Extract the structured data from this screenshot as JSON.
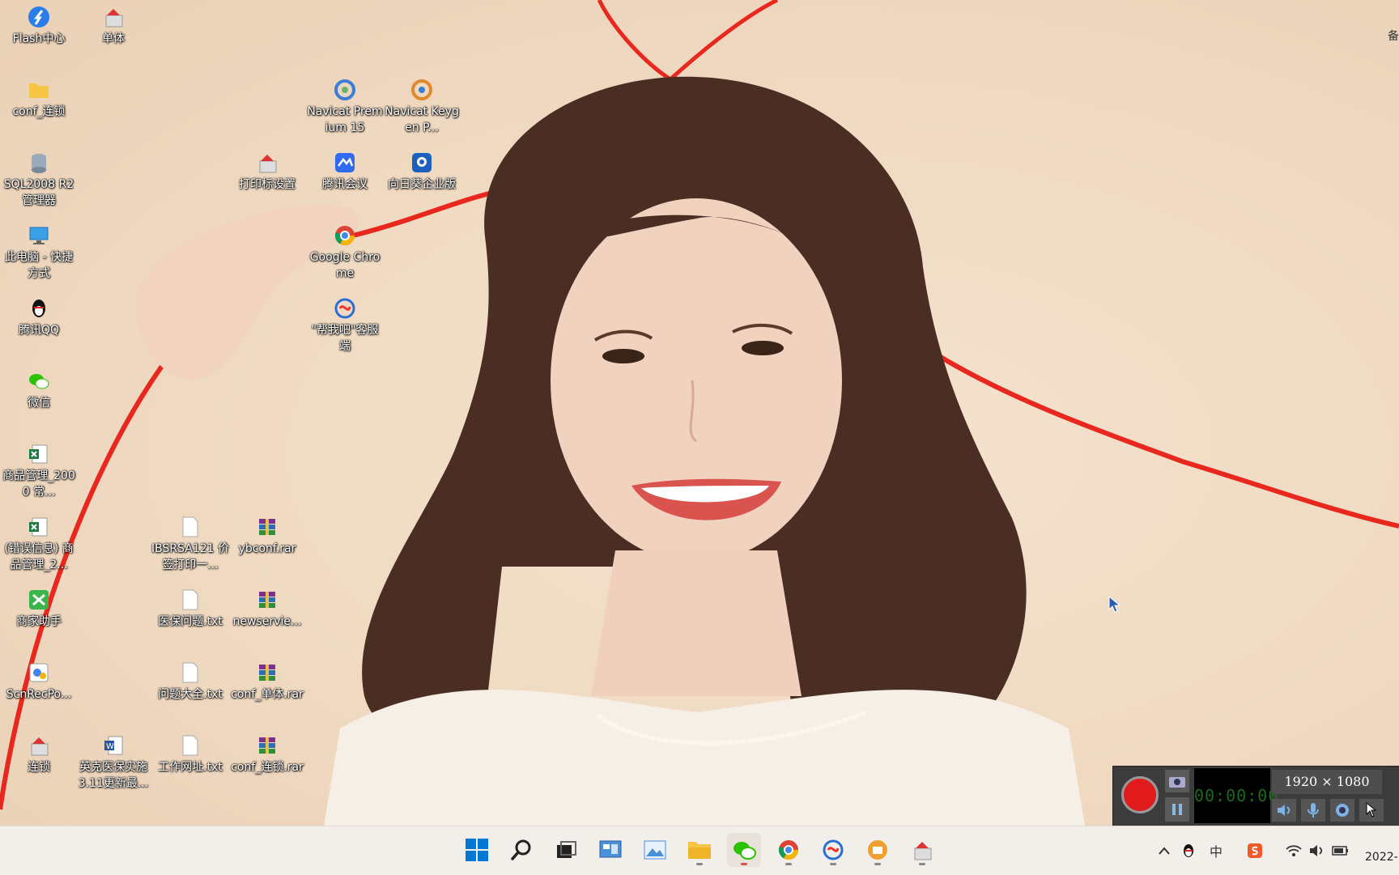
{
  "desktop": {
    "icons": [
      {
        "label": "Flash中心"
      },
      {
        "label": "单体"
      },
      {
        "label": "conf_连锁"
      },
      {
        "label": "Navicat Premium 15"
      },
      {
        "label": "Navicat Keygen P..."
      },
      {
        "label": "SQL2008 R2 管理器"
      },
      {
        "label": "打印标设置"
      },
      {
        "label": "腾讯会议"
      },
      {
        "label": "向日葵企业版"
      },
      {
        "label": "此电脑 - 快捷方式"
      },
      {
        "label": "Google Chrome"
      },
      {
        "label": "腾讯QQ"
      },
      {
        "label": "\"帮我吧\"客服端"
      },
      {
        "label": "微信"
      },
      {
        "label": "商品管理_2000 常..."
      },
      {
        "label": "(错误信息) 商品管理_2..."
      },
      {
        "label": "IBSRSA121 价签打印一..."
      },
      {
        "label": "ybconf.rar"
      },
      {
        "label": "商家助手"
      },
      {
        "label": "医保问题.txt"
      },
      {
        "label": "newservie..."
      },
      {
        "label": "ScnRecPo..."
      },
      {
        "label": "问题大全.txt"
      },
      {
        "label": "conf_单体.rar"
      },
      {
        "label": "连锁"
      },
      {
        "label": "英克医保实施3.11更新最..."
      },
      {
        "label": "工作网址.txt"
      },
      {
        "label": "conf_连锁.rar"
      }
    ],
    "edge_text": "备"
  },
  "recorder": {
    "resolution": "1920 × 1080",
    "timer": "00:00:00"
  },
  "taskbar": {
    "apps": [
      "start-icon",
      "search-icon",
      "task-view-icon",
      "control-panel-icon",
      "photos-icon",
      "file-explorer-icon",
      "wechat-icon",
      "chrome-icon",
      "helper-icon",
      "store-icon",
      "print-tool-icon"
    ],
    "ime": "中",
    "clock": "2022-"
  },
  "colors": {
    "accent": "#0078d4",
    "ribbon": "#e8281e",
    "record": "#e11b1b"
  }
}
